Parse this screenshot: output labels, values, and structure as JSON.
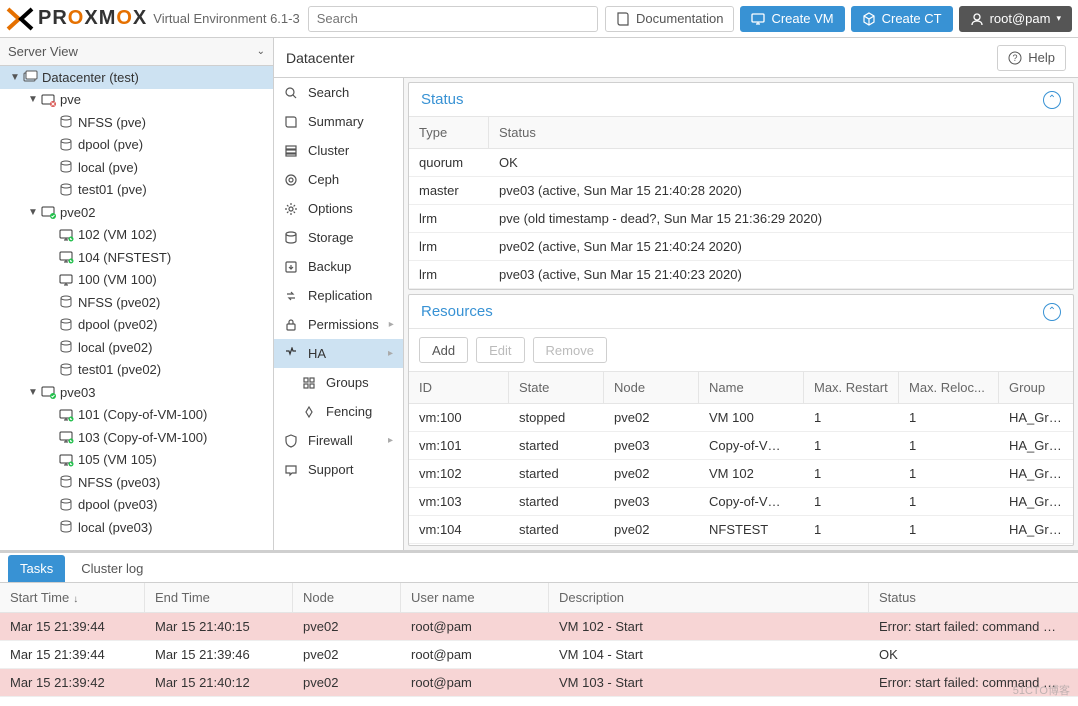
{
  "header": {
    "product": "PROXMOX",
    "subtitle": "Virtual Environment 6.1-3",
    "search_placeholder": "Search",
    "doc": "Documentation",
    "create_vm": "Create VM",
    "create_ct": "Create CT",
    "user": "root@pam"
  },
  "sidebar": {
    "view": "Server View",
    "tree": [
      {
        "depth": 0,
        "arrow": "▼",
        "type": "dc",
        "label": "Datacenter (test)",
        "sel": true
      },
      {
        "depth": 1,
        "arrow": "▼",
        "type": "node-down",
        "label": "pve"
      },
      {
        "depth": 2,
        "arrow": "",
        "type": "storage",
        "label": "NFSS (pve)"
      },
      {
        "depth": 2,
        "arrow": "",
        "type": "storage",
        "label": "dpool (pve)"
      },
      {
        "depth": 2,
        "arrow": "",
        "type": "storage",
        "label": "local (pve)"
      },
      {
        "depth": 2,
        "arrow": "",
        "type": "storage",
        "label": "test01 (pve)"
      },
      {
        "depth": 1,
        "arrow": "▼",
        "type": "node-up",
        "label": "pve02"
      },
      {
        "depth": 2,
        "arrow": "",
        "type": "vm-on",
        "label": "102 (VM 102)"
      },
      {
        "depth": 2,
        "arrow": "",
        "type": "vm-on",
        "label": "104 (NFSTEST)"
      },
      {
        "depth": 2,
        "arrow": "",
        "type": "vm-off",
        "label": "100 (VM 100)"
      },
      {
        "depth": 2,
        "arrow": "",
        "type": "storage",
        "label": "NFSS (pve02)"
      },
      {
        "depth": 2,
        "arrow": "",
        "type": "storage",
        "label": "dpool (pve02)"
      },
      {
        "depth": 2,
        "arrow": "",
        "type": "storage",
        "label": "local (pve02)"
      },
      {
        "depth": 2,
        "arrow": "",
        "type": "storage",
        "label": "test01 (pve02)"
      },
      {
        "depth": 1,
        "arrow": "▼",
        "type": "node-up",
        "label": "pve03"
      },
      {
        "depth": 2,
        "arrow": "",
        "type": "vm-on",
        "label": "101 (Copy-of-VM-100)"
      },
      {
        "depth": 2,
        "arrow": "",
        "type": "vm-on",
        "label": "103 (Copy-of-VM-100)"
      },
      {
        "depth": 2,
        "arrow": "",
        "type": "vm-on",
        "label": "105 (VM 105)"
      },
      {
        "depth": 2,
        "arrow": "",
        "type": "storage",
        "label": "NFSS (pve03)"
      },
      {
        "depth": 2,
        "arrow": "",
        "type": "storage",
        "label": "dpool (pve03)"
      },
      {
        "depth": 2,
        "arrow": "",
        "type": "storage",
        "label": "local (pve03)"
      }
    ]
  },
  "breadcrumb": {
    "title": "Datacenter",
    "help": "Help"
  },
  "submenu": {
    "items": [
      {
        "icon": "search",
        "label": "Search"
      },
      {
        "icon": "book",
        "label": "Summary"
      },
      {
        "icon": "cluster",
        "label": "Cluster"
      },
      {
        "icon": "ceph",
        "label": "Ceph"
      },
      {
        "icon": "gear",
        "label": "Options"
      },
      {
        "icon": "storage",
        "label": "Storage"
      },
      {
        "icon": "backup",
        "label": "Backup"
      },
      {
        "icon": "replication",
        "label": "Replication"
      },
      {
        "icon": "permissions",
        "label": "Permissions",
        "expand": true
      },
      {
        "icon": "ha",
        "label": "HA",
        "sel": true,
        "expand": true
      },
      {
        "icon": "groups",
        "label": "Groups",
        "sub": true
      },
      {
        "icon": "fencing",
        "label": "Fencing",
        "sub": true
      },
      {
        "icon": "firewall",
        "label": "Firewall",
        "expand": true
      },
      {
        "icon": "support",
        "label": "Support"
      }
    ]
  },
  "status_panel": {
    "title": "Status",
    "headers": [
      "Type",
      "Status"
    ],
    "rows": [
      {
        "type": "quorum",
        "status": "OK"
      },
      {
        "type": "master",
        "status": "pve03 (active, Sun Mar 15 21:40:28 2020)"
      },
      {
        "type": "lrm",
        "status": "pve (old timestamp - dead?, Sun Mar 15 21:36:29 2020)"
      },
      {
        "type": "lrm",
        "status": "pve02 (active, Sun Mar 15 21:40:24 2020)"
      },
      {
        "type": "lrm",
        "status": "pve03 (active, Sun Mar 15 21:40:23 2020)"
      }
    ]
  },
  "resources_panel": {
    "title": "Resources",
    "buttons": {
      "add": "Add",
      "edit": "Edit",
      "remove": "Remove"
    },
    "headers": [
      "ID",
      "State",
      "Node",
      "Name",
      "Max. Restart",
      "Max. Reloc...",
      "Group"
    ],
    "rows": [
      {
        "id": "vm:100",
        "state": "stopped",
        "node": "pve02",
        "name": "VM 100",
        "mr": "1",
        "ml": "1",
        "group": "HA_Grou"
      },
      {
        "id": "vm:101",
        "state": "started",
        "node": "pve03",
        "name": "Copy-of-V…",
        "mr": "1",
        "ml": "1",
        "group": "HA_Grou"
      },
      {
        "id": "vm:102",
        "state": "started",
        "node": "pve02",
        "name": "VM 102",
        "mr": "1",
        "ml": "1",
        "group": "HA_Grou"
      },
      {
        "id": "vm:103",
        "state": "started",
        "node": "pve03",
        "name": "Copy-of-V…",
        "mr": "1",
        "ml": "1",
        "group": "HA_Grou"
      },
      {
        "id": "vm:104",
        "state": "started",
        "node": "pve02",
        "name": "NFSTEST",
        "mr": "1",
        "ml": "1",
        "group": "HA_Grou"
      },
      {
        "id": "vm:105",
        "state": "started",
        "node": "pve03",
        "name": "VM 105",
        "mr": "1",
        "ml": "1",
        "group": "HA_Grou"
      }
    ]
  },
  "tasks": {
    "tabs": [
      "Tasks",
      "Cluster log"
    ],
    "headers": [
      "Start Time",
      "End Time",
      "Node",
      "User name",
      "Description",
      "Status"
    ],
    "rows": [
      {
        "start": "Mar 15 21:39:44",
        "end": "Mar 15 21:40:15",
        "node": "pve02",
        "user": "root@pam",
        "desc": "VM 102 - Start",
        "status": "Error: start failed: command …",
        "err": true
      },
      {
        "start": "Mar 15 21:39:44",
        "end": "Mar 15 21:39:46",
        "node": "pve02",
        "user": "root@pam",
        "desc": "VM 104 - Start",
        "status": "OK",
        "err": false
      },
      {
        "start": "Mar 15 21:39:42",
        "end": "Mar 15 21:40:12",
        "node": "pve02",
        "user": "root@pam",
        "desc": "VM 103 - Start",
        "status": "Error: start failed: command …",
        "err": true
      }
    ]
  },
  "watermark": "51CTO博客"
}
